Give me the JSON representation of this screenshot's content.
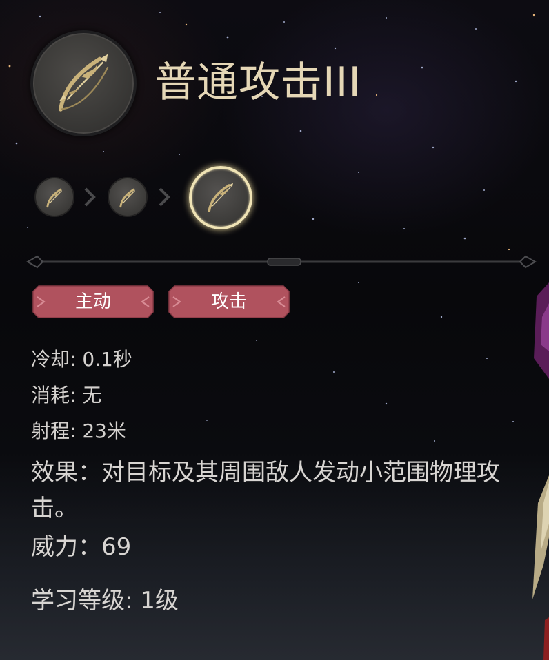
{
  "skill": {
    "name": "普通攻击III",
    "icon": "bow-icon"
  },
  "upgrade_path": [
    {
      "tier": 1,
      "icon": "bow-icon",
      "state": "previous"
    },
    {
      "tier": 2,
      "icon": "bow-icon",
      "state": "previous"
    },
    {
      "tier": 3,
      "icon": "bow-icon",
      "state": "current"
    }
  ],
  "tags": [
    {
      "label": "主动"
    },
    {
      "label": "攻击"
    }
  ],
  "stats": {
    "cooldown": "冷却: 0.1秒",
    "cost": "消耗: 无",
    "range": "射程: 23米"
  },
  "effect": "效果：对目标及其周围敌人发动小范围物理攻击。",
  "power": "威力：69",
  "learn_level": "学习等级:  1级",
  "colors": {
    "title_gold": "#e5d7b6",
    "tag_fill": "#b0525e",
    "current_ring": "#efe3b5"
  }
}
